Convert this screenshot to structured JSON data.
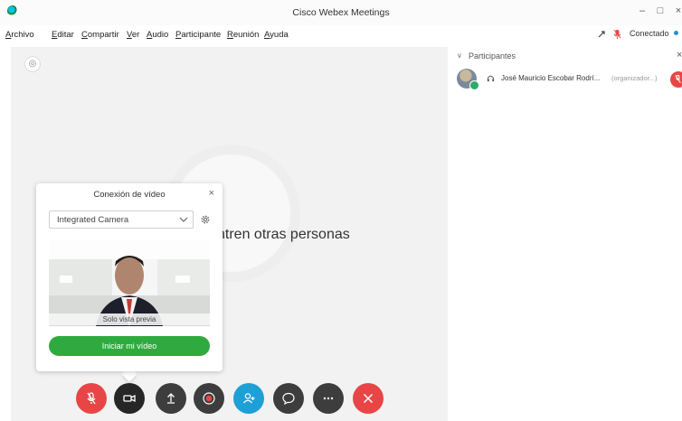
{
  "window": {
    "title": "Cisco Webex Meetings",
    "minimize": "–",
    "maximize": "□",
    "close": "×"
  },
  "menu": [
    "Archivo",
    "Editar",
    "Compartir",
    "Ver",
    "Audio",
    "Participante",
    "Reunión",
    "Ayuda"
  ],
  "status": {
    "connection": "Conectado"
  },
  "stage": {
    "waiting_message": "ntren otras personas"
  },
  "video_popover": {
    "title": "Conexión de vídeo",
    "close": "×",
    "camera_selected": "Integrated Camera",
    "preview_caption": "Solo vista previa",
    "start_button": "Iniciar mi vídeo"
  },
  "controls": [
    {
      "name": "mute-button",
      "icon": "mic-muted-icon",
      "color": "#e84646"
    },
    {
      "name": "video-button",
      "icon": "video-camera-icon",
      "color": "#262626"
    },
    {
      "name": "share-button",
      "icon": "share-upload-icon",
      "color": "#3d3d3d"
    },
    {
      "name": "record-button",
      "icon": "record-icon",
      "color": "#3d3d3d"
    },
    {
      "name": "participants-button",
      "icon": "add-participant-icon",
      "color": "#1ea0d6"
    },
    {
      "name": "chat-button",
      "icon": "chat-bubble-icon",
      "color": "#3d3d3d"
    },
    {
      "name": "more-button",
      "icon": "more-options-icon",
      "color": "#3d3d3d"
    },
    {
      "name": "leave-button",
      "icon": "close-x-icon",
      "color": "#e84646"
    }
  ],
  "participants_panel": {
    "title": "Participantes",
    "close": "×",
    "participants": [
      {
        "name": "José Mauricio Escobar Rodrí...",
        "role": "(organizador...)"
      }
    ]
  }
}
